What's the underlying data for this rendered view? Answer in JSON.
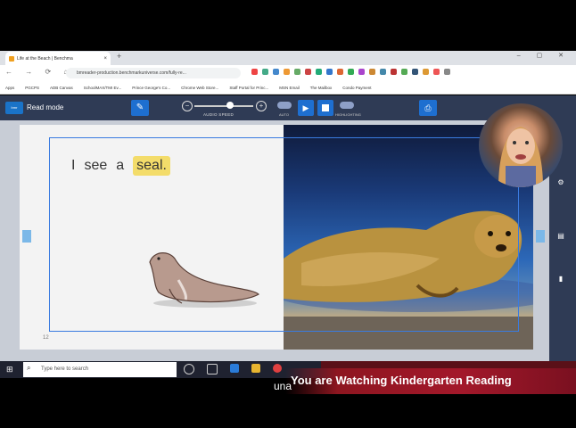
{
  "browser": {
    "tab_title": "Life at the Beach | Benchma",
    "tab_close": "×",
    "new_tab": "+",
    "window_controls": "– ▢ ✕",
    "nav": "← → ⟳ ⌂",
    "url": "bmreader-production.benchmarkuniverse.com/fully-re...",
    "bookmarks": [
      "Apps",
      "PGCPS",
      "ADB Canvas",
      "SchoolMAX/TMI Ev...",
      "Prince George's Co...",
      "Chrome Web Store...",
      "Staff Portal for Princ...",
      "MSN Email",
      "The Mailbox",
      "Condo Payment"
    ]
  },
  "toolbar": {
    "logo": "bmr",
    "mode": "Read mode",
    "audio_speed_label": "AUDIO SPEED",
    "audio_speed_level": 0.6,
    "auto_label": "AUTO",
    "highlight_label": "HIGHLIGHTING",
    "minus": "−",
    "plus": "+"
  },
  "book": {
    "words": [
      "I",
      "see",
      "a"
    ],
    "highlighted_word": "seal.",
    "page_number": "12"
  },
  "taskbar": {
    "search_placeholder": "Type here to search"
  },
  "overlay": {
    "banner": "You are Watching Kindergarten Reading",
    "partial": "una"
  },
  "colors": {
    "accent": "#1e6fd0",
    "toolbar": "#2f3b55",
    "highlight": "#f3dc6a",
    "banner": "#a3182a"
  }
}
